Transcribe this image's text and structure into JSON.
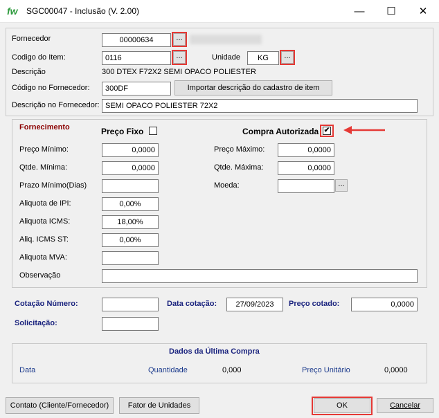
{
  "window": {
    "logo": "fw",
    "title": "SGC00047 - Inclusão  (V. 2.00)",
    "minimize": "—",
    "maximize": "☐",
    "close": "✕"
  },
  "header": {
    "fornecedor_label": "Fornecedor",
    "fornecedor_value": "00000634",
    "codigo_item_label": "Codigo do Item:",
    "codigo_item_value": "0116",
    "unidade_label": "Unidade",
    "unidade_value": "KG",
    "descricao_label": "Descrição",
    "descricao_value": "300 DTEX F72X2 SEMI OPACO POLIESTER",
    "codigo_fornecedor_label": "Código no Fornecedor:",
    "codigo_fornecedor_value": "300DF",
    "importar_label": "Importar descrição do cadastro de item",
    "descricao_fornecedor_label": "Descrição no Fornecedor:",
    "descricao_fornecedor_value": "SEMI OPACO POLIESTER 72X2",
    "ellipsis": "..."
  },
  "fornecimento": {
    "title": "Fornecimento",
    "preco_fixo_label": "Preço Fixo",
    "compra_autorizada_label": "Compra Autorizada",
    "compra_autorizada_check": "✔",
    "preco_minimo_label": "Preço Mínimo:",
    "preco_minimo_value": "0,0000",
    "preco_maximo_label": "Preço Máximo:",
    "preco_maximo_value": "0,0000",
    "qtde_minima_label": "Qtde. Mínima:",
    "qtde_minima_value": "0,0000",
    "qtde_maxima_label": "Qtde. Máxima:",
    "qtde_maxima_value": "0,0000",
    "prazo_minimo_label": "Prazo Mínimo(Dias)",
    "moeda_label": "Moeda:",
    "aliq_ipi_label": "Aliquota de IPI:",
    "aliq_ipi_value": "0,00%",
    "aliq_icms_label": "Aliquota ICMS:",
    "aliq_icms_value": "18,00%",
    "aliq_icms_st_label": "Aliq. ICMS ST:",
    "aliq_icms_st_value": "0,00%",
    "aliq_mva_label": "Aliquota MVA:",
    "observacao_label": "Observação"
  },
  "cotacao": {
    "numero_label": "Cotação Número:",
    "data_label": "Data cotação:",
    "data_value": "27/09/2023",
    "preco_label": "Preço cotado:",
    "preco_value": "0,0000",
    "solicitacao_label": "Solicitação:"
  },
  "ultima_compra": {
    "title": "Dados da Última Compra",
    "data_label": "Data",
    "quantidade_label": "Quantidade",
    "quantidade_value": "0,000",
    "preco_unitario_label": "Preço Unitário",
    "preco_unitario_value": "0,0000"
  },
  "footer": {
    "contato_label": "Contato (Cliente/Fornecedor)",
    "fator_label": "Fator de Unidades",
    "ok_label": "OK",
    "cancelar_label": "Cancelar"
  },
  "colors": {
    "highlight": "#e53935",
    "section_title": "#8b0000",
    "label_blue": "#1a237e"
  }
}
